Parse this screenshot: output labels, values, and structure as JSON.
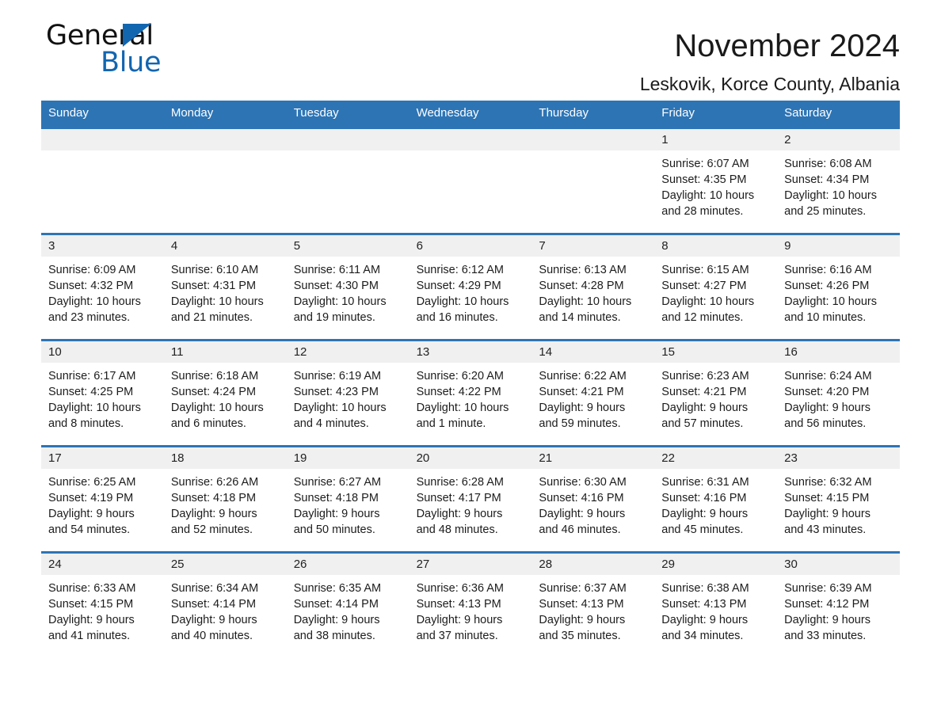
{
  "brand": {
    "name_part1": "General",
    "name_part2": "Blue",
    "logo_icon": "blue-triangle-icon"
  },
  "header": {
    "title": "November 2024",
    "subtitle": "Leskovik, Korce County, Albania"
  },
  "colors": {
    "header_blue": "#2d74b5",
    "brand_blue": "#1266b0",
    "day_number_bg": "#f0f0f0",
    "text": "#1a1a1a"
  },
  "weekdays": [
    "Sunday",
    "Monday",
    "Tuesday",
    "Wednesday",
    "Thursday",
    "Friday",
    "Saturday"
  ],
  "labels": {
    "sunrise_prefix": "Sunrise:",
    "sunset_prefix": "Sunset:",
    "daylight_prefix": "Daylight:"
  },
  "weeks": [
    [
      {
        "empty": true
      },
      {
        "empty": true
      },
      {
        "empty": true
      },
      {
        "empty": true
      },
      {
        "empty": true
      },
      {
        "day": "1",
        "sunrise": "Sunrise: 6:07 AM",
        "sunset": "Sunset: 4:35 PM",
        "daylight_1": "Daylight: 10 hours",
        "daylight_2": "and 28 minutes."
      },
      {
        "day": "2",
        "sunrise": "Sunrise: 6:08 AM",
        "sunset": "Sunset: 4:34 PM",
        "daylight_1": "Daylight: 10 hours",
        "daylight_2": "and 25 minutes."
      }
    ],
    [
      {
        "day": "3",
        "sunrise": "Sunrise: 6:09 AM",
        "sunset": "Sunset: 4:32 PM",
        "daylight_1": "Daylight: 10 hours",
        "daylight_2": "and 23 minutes."
      },
      {
        "day": "4",
        "sunrise": "Sunrise: 6:10 AM",
        "sunset": "Sunset: 4:31 PM",
        "daylight_1": "Daylight: 10 hours",
        "daylight_2": "and 21 minutes."
      },
      {
        "day": "5",
        "sunrise": "Sunrise: 6:11 AM",
        "sunset": "Sunset: 4:30 PM",
        "daylight_1": "Daylight: 10 hours",
        "daylight_2": "and 19 minutes."
      },
      {
        "day": "6",
        "sunrise": "Sunrise: 6:12 AM",
        "sunset": "Sunset: 4:29 PM",
        "daylight_1": "Daylight: 10 hours",
        "daylight_2": "and 16 minutes."
      },
      {
        "day": "7",
        "sunrise": "Sunrise: 6:13 AM",
        "sunset": "Sunset: 4:28 PM",
        "daylight_1": "Daylight: 10 hours",
        "daylight_2": "and 14 minutes."
      },
      {
        "day": "8",
        "sunrise": "Sunrise: 6:15 AM",
        "sunset": "Sunset: 4:27 PM",
        "daylight_1": "Daylight: 10 hours",
        "daylight_2": "and 12 minutes."
      },
      {
        "day": "9",
        "sunrise": "Sunrise: 6:16 AM",
        "sunset": "Sunset: 4:26 PM",
        "daylight_1": "Daylight: 10 hours",
        "daylight_2": "and 10 minutes."
      }
    ],
    [
      {
        "day": "10",
        "sunrise": "Sunrise: 6:17 AM",
        "sunset": "Sunset: 4:25 PM",
        "daylight_1": "Daylight: 10 hours",
        "daylight_2": "and 8 minutes."
      },
      {
        "day": "11",
        "sunrise": "Sunrise: 6:18 AM",
        "sunset": "Sunset: 4:24 PM",
        "daylight_1": "Daylight: 10 hours",
        "daylight_2": "and 6 minutes."
      },
      {
        "day": "12",
        "sunrise": "Sunrise: 6:19 AM",
        "sunset": "Sunset: 4:23 PM",
        "daylight_1": "Daylight: 10 hours",
        "daylight_2": "and 4 minutes."
      },
      {
        "day": "13",
        "sunrise": "Sunrise: 6:20 AM",
        "sunset": "Sunset: 4:22 PM",
        "daylight_1": "Daylight: 10 hours",
        "daylight_2": "and 1 minute."
      },
      {
        "day": "14",
        "sunrise": "Sunrise: 6:22 AM",
        "sunset": "Sunset: 4:21 PM",
        "daylight_1": "Daylight: 9 hours",
        "daylight_2": "and 59 minutes."
      },
      {
        "day": "15",
        "sunrise": "Sunrise: 6:23 AM",
        "sunset": "Sunset: 4:21 PM",
        "daylight_1": "Daylight: 9 hours",
        "daylight_2": "and 57 minutes."
      },
      {
        "day": "16",
        "sunrise": "Sunrise: 6:24 AM",
        "sunset": "Sunset: 4:20 PM",
        "daylight_1": "Daylight: 9 hours",
        "daylight_2": "and 56 minutes."
      }
    ],
    [
      {
        "day": "17",
        "sunrise": "Sunrise: 6:25 AM",
        "sunset": "Sunset: 4:19 PM",
        "daylight_1": "Daylight: 9 hours",
        "daylight_2": "and 54 minutes."
      },
      {
        "day": "18",
        "sunrise": "Sunrise: 6:26 AM",
        "sunset": "Sunset: 4:18 PM",
        "daylight_1": "Daylight: 9 hours",
        "daylight_2": "and 52 minutes."
      },
      {
        "day": "19",
        "sunrise": "Sunrise: 6:27 AM",
        "sunset": "Sunset: 4:18 PM",
        "daylight_1": "Daylight: 9 hours",
        "daylight_2": "and 50 minutes."
      },
      {
        "day": "20",
        "sunrise": "Sunrise: 6:28 AM",
        "sunset": "Sunset: 4:17 PM",
        "daylight_1": "Daylight: 9 hours",
        "daylight_2": "and 48 minutes."
      },
      {
        "day": "21",
        "sunrise": "Sunrise: 6:30 AM",
        "sunset": "Sunset: 4:16 PM",
        "daylight_1": "Daylight: 9 hours",
        "daylight_2": "and 46 minutes."
      },
      {
        "day": "22",
        "sunrise": "Sunrise: 6:31 AM",
        "sunset": "Sunset: 4:16 PM",
        "daylight_1": "Daylight: 9 hours",
        "daylight_2": "and 45 minutes."
      },
      {
        "day": "23",
        "sunrise": "Sunrise: 6:32 AM",
        "sunset": "Sunset: 4:15 PM",
        "daylight_1": "Daylight: 9 hours",
        "daylight_2": "and 43 minutes."
      }
    ],
    [
      {
        "day": "24",
        "sunrise": "Sunrise: 6:33 AM",
        "sunset": "Sunset: 4:15 PM",
        "daylight_1": "Daylight: 9 hours",
        "daylight_2": "and 41 minutes."
      },
      {
        "day": "25",
        "sunrise": "Sunrise: 6:34 AM",
        "sunset": "Sunset: 4:14 PM",
        "daylight_1": "Daylight: 9 hours",
        "daylight_2": "and 40 minutes."
      },
      {
        "day": "26",
        "sunrise": "Sunrise: 6:35 AM",
        "sunset": "Sunset: 4:14 PM",
        "daylight_1": "Daylight: 9 hours",
        "daylight_2": "and 38 minutes."
      },
      {
        "day": "27",
        "sunrise": "Sunrise: 6:36 AM",
        "sunset": "Sunset: 4:13 PM",
        "daylight_1": "Daylight: 9 hours",
        "daylight_2": "and 37 minutes."
      },
      {
        "day": "28",
        "sunrise": "Sunrise: 6:37 AM",
        "sunset": "Sunset: 4:13 PM",
        "daylight_1": "Daylight: 9 hours",
        "daylight_2": "and 35 minutes."
      },
      {
        "day": "29",
        "sunrise": "Sunrise: 6:38 AM",
        "sunset": "Sunset: 4:13 PM",
        "daylight_1": "Daylight: 9 hours",
        "daylight_2": "and 34 minutes."
      },
      {
        "day": "30",
        "sunrise": "Sunrise: 6:39 AM",
        "sunset": "Sunset: 4:12 PM",
        "daylight_1": "Daylight: 9 hours",
        "daylight_2": "and 33 minutes."
      }
    ]
  ]
}
